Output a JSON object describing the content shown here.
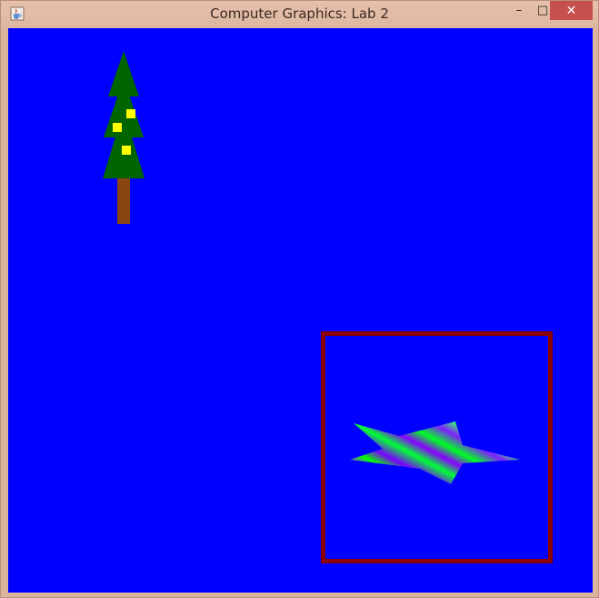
{
  "window": {
    "title": "Computer Graphics: Lab 2",
    "icon": "java-cup-icon",
    "controls": {
      "minimize": "–",
      "maximize": "□",
      "close": "✕"
    }
  },
  "scene": {
    "background_color": "#0000ff",
    "tree": {
      "foliage_color": "#006400",
      "trunk_color": "#8b4513",
      "ornament_color": "#ffff00",
      "ornament_count": 3
    },
    "frame": {
      "border_color": "#8b0000"
    },
    "star": {
      "gradient_colors": [
        "#9b30ff",
        "#00ff00",
        "#7a00ff",
        "#33ff66"
      ]
    }
  }
}
